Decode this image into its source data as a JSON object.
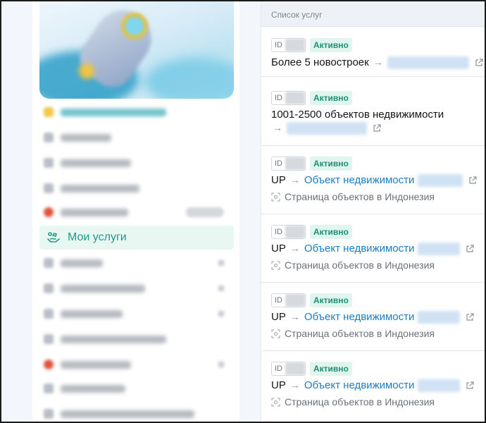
{
  "sidebar": {
    "active_item_label": "Мои услуги",
    "active_item_icon": "services-hands-icon"
  },
  "panel": {
    "header": "Список услуг",
    "id_label": "ID",
    "cards": [
      {
        "status": "Активно",
        "title": "Более 5 новостроек",
        "arrow": "→"
      },
      {
        "status": "Активно",
        "title": "1001-2500 объектов недвижимости",
        "arrow": "→"
      },
      {
        "status": "Активно",
        "prefix": "UP",
        "arrow": "→",
        "link": "Объект недвижимости",
        "subtitle": "Страница объектов в Индонезия"
      },
      {
        "status": "Активно",
        "prefix": "UP",
        "arrow": "→",
        "link": "Объект недвижимости",
        "subtitle": "Страница объектов в Индонезия"
      },
      {
        "status": "Активно",
        "prefix": "UP",
        "arrow": "→",
        "link": "Объект недвижимости",
        "subtitle": "Страница объектов в Индонезия"
      },
      {
        "status": "Активно",
        "prefix": "UP",
        "arrow": "→",
        "link": "Объект недвижимости",
        "subtitle": "Страница объектов в Индонезия"
      }
    ]
  },
  "colors": {
    "accent": "#1c9a86",
    "link": "#1c7ec2",
    "status_bg": "#dff5ee",
    "status_text": "#1f8f73"
  }
}
